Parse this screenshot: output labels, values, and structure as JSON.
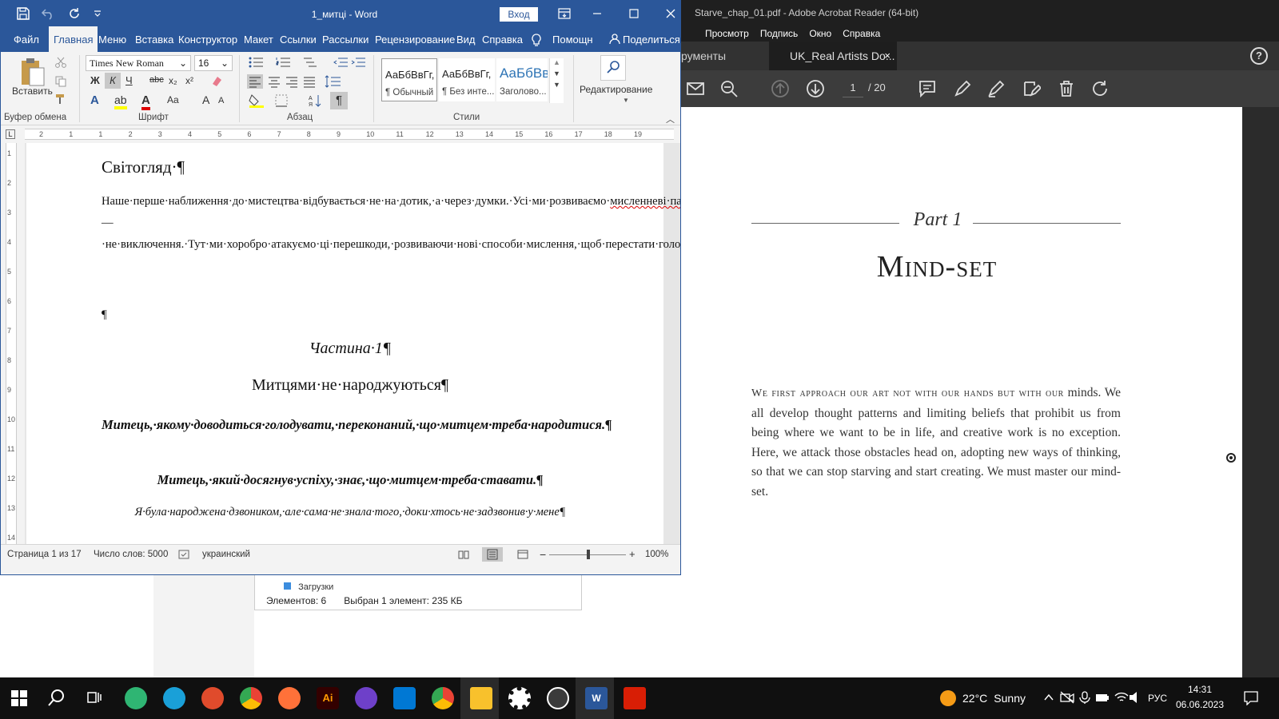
{
  "acrobat": {
    "title": "Starve_chap_01.pdf - Adobe Acrobat Reader (64-bit)",
    "menu": [
      "Просмотр",
      "Подпись",
      "Окно",
      "Справка"
    ],
    "tab_tools": "рументы",
    "tab_doc": "UK_Real Artists Do...",
    "tab_close": "×",
    "help": "?",
    "page_current": "1",
    "page_total": "/ 20",
    "pdf": {
      "part_label": "Part 1",
      "title": "Mind-set",
      "body_smallcaps": "We first approach our art not with our hands but with our",
      "body_rest": "minds. We all develop thought patterns and limiting beliefs that prohibit us from being where we want to be in life, and creative work is no exception. Here, we attack those obstacles head on, adopting new ways of thinking, so that we can stop starving and start creating. We must master our mind-set."
    }
  },
  "explorer": {
    "row_item": "Загрузки",
    "items_count": "Элементов: 6",
    "selected": "Выбран 1 элемент: 235 КБ"
  },
  "word": {
    "doc_name": "1_митці",
    "app": "Word",
    "title_sep": "-",
    "login": "Вход",
    "tabs": [
      "Файл",
      "Главная",
      "Меню",
      "Вставка",
      "Конструктор",
      "Макет",
      "Ссылки",
      "Рассылки",
      "Рецензирование",
      "Вид",
      "Справка",
      "Помощн",
      "Поделиться"
    ],
    "ribbon": {
      "paste": "Вставить",
      "font_name": "Times New Roman",
      "font_size": "16",
      "bold": "Ж",
      "italic": "К",
      "underline": "Ч",
      "strike": "abc",
      "sub": "x₂",
      "sup": "x²",
      "case": "Aa",
      "grow": "A",
      "shrink": "A",
      "styles": [
        {
          "sample": "АаБбВвГг,",
          "name": "¶ Обычный"
        },
        {
          "sample": "АаБбВвГг,",
          "name": "¶ Без инте..."
        },
        {
          "sample": "АаБбВв",
          "name": "Заголово..."
        }
      ],
      "editing": "Редактирование",
      "groups": [
        "Буфер обмена",
        "Шрифт",
        "Абзац",
        "Стили"
      ]
    },
    "ruler_numbers": [
      "2",
      "1",
      "1",
      "2",
      "3",
      "4",
      "5",
      "6",
      "7",
      "8",
      "9",
      "10",
      "11",
      "12",
      "13",
      "14",
      "15",
      "16",
      "17",
      "18",
      "19"
    ],
    "vruler_numbers": [
      "1",
      "2",
      "3",
      "4",
      "5",
      "6",
      "7",
      "8",
      "9",
      "10",
      "11",
      "12",
      "13",
      "14"
    ],
    "document": {
      "heading": "Світогляд·¶",
      "para_before_squiggle": "Наше·перше·наближення·до·мистецтва·відбувається·не·на·дотик,·а·через·думки.·Усі·ми·розвиваємо·",
      "para_squiggle": "мисленневі·патерни",
      "para_after_squiggle": "·та·обмежуючі·переконання,·які·стають·нам·на·перешкоді·до·того·життя,·якого·прагнемо,·і·творчість·—·не·виключення.·Тут·ми·хоробро·атакуємо·ці·перешкоди,·розвиваючи·нові·способи·мислення,·щоб·перестати·голодувати·та·почати·творити.·Ми·повинні·стати·володарями·свого·світогляду.¶",
      "empty_para": "¶",
      "part": "Частина·1¶",
      "subtitle": "Митцями·не·народжуються¶",
      "quote1": "Митець,·якому·доводиться·голодувати,·переконаний,·що·митцем·треба·народитися.¶",
      "quote2": "Митець,·який·досягнув·успіху,·знає,·що·митцем·треба·ставати.¶",
      "quote3": "Я·була·народжена·дзвоником,·але·сама·не·знала·того,·доки·хтось·не·задзвонив·у·мене¶"
    },
    "status": {
      "page": "Страница 1 из 17",
      "words": "Число слов: 5000",
      "language": "украинский",
      "zoom": "100%",
      "zoom_minus": "−",
      "zoom_plus": "+"
    }
  },
  "taskbar": {
    "temperature": "22°C",
    "weather": "Sunny",
    "language": "РУС",
    "time": "14:31",
    "date": "06.06.2023"
  },
  "colors": {
    "word_blue": "#2b579a",
    "acrobat_dark": "#1f1f1f",
    "taskbar": "#101010"
  }
}
